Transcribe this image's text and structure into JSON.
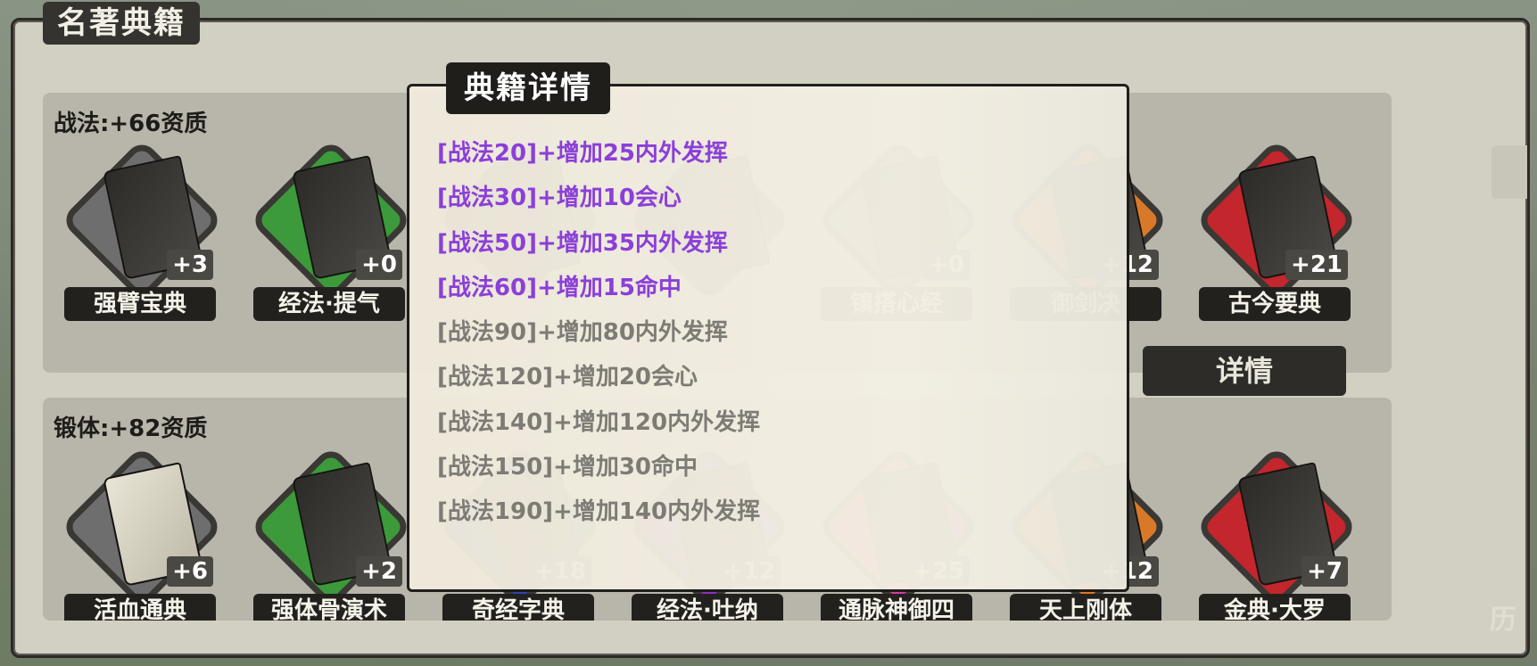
{
  "window": {
    "title": "名著典籍",
    "corner_label": "历"
  },
  "sections": [
    {
      "title": "战法:+66资质",
      "items": [
        {
          "label": "强臂宝典",
          "bonus": "+3",
          "frame_color": "#6e6e6e"
        },
        {
          "label": "经法·提气",
          "bonus": "+0",
          "frame_color": "#3c9a3a"
        },
        {
          "label": "",
          "bonus": "",
          "frame_color": "#3a3834"
        },
        {
          "label": "",
          "bonus": "",
          "frame_color": "#3a3834"
        },
        {
          "label": "镇搭心经",
          "bonus": "+0",
          "frame_color": "#6e6e6e"
        },
        {
          "label": "御剑决",
          "bonus": "+12",
          "frame_color": "#d8792a"
        },
        {
          "label": "古今要典",
          "bonus": "+21",
          "frame_color": "#c3262c"
        }
      ]
    },
    {
      "title": "锻体:+82资质",
      "items": [
        {
          "label": "活血通典",
          "bonus": "+6",
          "frame_color": "#6e6e6e"
        },
        {
          "label": "强体骨演术",
          "bonus": "+2",
          "frame_color": "#3c9a3a"
        },
        {
          "label": "奇经字典",
          "bonus": "+18",
          "frame_color": "#2b43b5"
        },
        {
          "label": "经法·吐纳",
          "bonus": "+12",
          "frame_color": "#8a2fc9"
        },
        {
          "label": "通脉神御四",
          "bonus": "+25",
          "frame_color": "#d63ba3"
        },
        {
          "label": "天上刚体",
          "bonus": "+12",
          "frame_color": "#d8792a"
        },
        {
          "label": "金典·大罗",
          "bonus": "+7",
          "frame_color": "#c3262c"
        }
      ]
    }
  ],
  "detail_button": {
    "label": "详情"
  },
  "modal": {
    "title": "典籍详情",
    "entries": [
      {
        "text": "[战法20]+增加25内外发挥",
        "unlocked": true
      },
      {
        "text": "[战法30]+增加10会心",
        "unlocked": true
      },
      {
        "text": "[战法50]+增加35内外发挥",
        "unlocked": true
      },
      {
        "text": "[战法60]+增加15命中",
        "unlocked": true
      },
      {
        "text": "[战法90]+增加80内外发挥",
        "unlocked": false
      },
      {
        "text": "[战法120]+增加20会心",
        "unlocked": false
      },
      {
        "text": "[战法140]+增加120内外发挥",
        "unlocked": false
      },
      {
        "text": "[战法150]+增加30命中",
        "unlocked": false
      },
      {
        "text": "[战法190]+增加140内外发挥",
        "unlocked": false
      }
    ]
  },
  "colors": {
    "unlocked_text": "#8b3fd9",
    "locked_text": "#7e7b75"
  }
}
